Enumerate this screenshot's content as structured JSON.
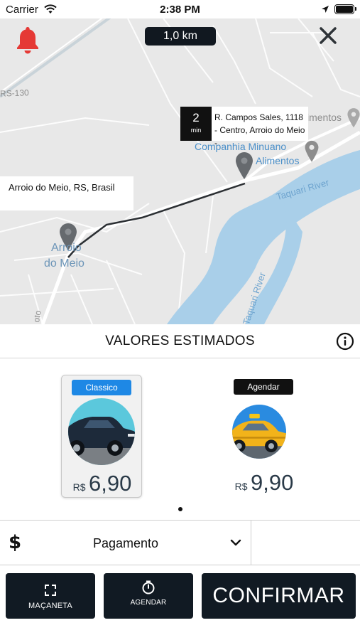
{
  "status_bar": {
    "carrier": "Carrier",
    "time": "2:38 PM",
    "icons": [
      "wifi-icon",
      "location-arrow-icon",
      "battery-icon"
    ]
  },
  "map": {
    "distance": "1,0 km",
    "icons": [
      "bell-icon",
      "close-icon",
      "map-pin-icon"
    ],
    "labels": {
      "road": "RS-130",
      "place_partial": "imentos",
      "company_line1": "Companhia Minuano",
      "company_line2": "Alimentos",
      "river": "Taquari River",
      "river_vertical": "Taquari River",
      "town_line1": "Arroio",
      "town_line2": "do Meio",
      "street_fragment": "oto"
    },
    "destination": {
      "eta_value": "2",
      "eta_unit": "min",
      "address": "R. Campos Sales, 1118 - Centro, Arroio do Meio -"
    },
    "origin": {
      "address": "Arroio do Meio, RS, Brasil"
    }
  },
  "estimates": {
    "title": "VALORES ESTIMADOS",
    "options": [
      {
        "badge": "Classico",
        "badge_color": "#1e88e5",
        "currency": "R$",
        "amount": "6,90",
        "image": "dark-sedan-icon",
        "selected": true
      },
      {
        "badge": "Agendar",
        "badge_color": "#111111",
        "currency": "R$",
        "amount": "9,90",
        "image": "yellow-taxi-icon",
        "selected": false
      }
    ]
  },
  "payment": {
    "icon": "dollar-icon",
    "label": "Pagamento"
  },
  "actions": {
    "macaneta_label": "MAÇANETA",
    "agendar_label": "AGENDAR",
    "confirm_label": "CONFIRMAR"
  },
  "colors": {
    "dark_button": "#111a23",
    "accent_blue": "#1e88e5",
    "bell_red": "#e53935",
    "water": "#a9cfe9",
    "map_bg": "#e8e8e8"
  }
}
